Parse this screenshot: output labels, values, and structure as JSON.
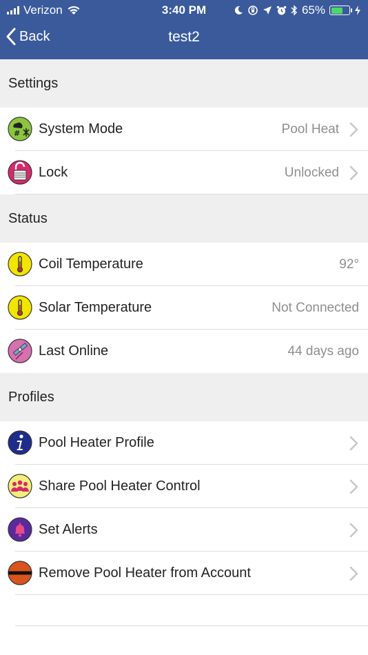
{
  "status_bar": {
    "carrier": "Verizon",
    "time": "3:40 PM",
    "battery_percent": "65%",
    "battery_level": 0.65
  },
  "nav": {
    "back_label": "Back",
    "title": "test2"
  },
  "sections": {
    "settings": {
      "title": "Settings",
      "rows": [
        {
          "label": "System Mode",
          "value": "Pool Heat"
        },
        {
          "label": "Lock",
          "value": "Unlocked"
        }
      ]
    },
    "status": {
      "title": "Status",
      "rows": [
        {
          "label": "Coil Temperature",
          "value": "92°"
        },
        {
          "label": "Solar Temperature",
          "value": "Not Connected"
        },
        {
          "label": "Last Online",
          "value": "44 days ago"
        }
      ]
    },
    "profiles": {
      "title": "Profiles",
      "rows": [
        {
          "label": "Pool Heater Profile"
        },
        {
          "label": "Share Pool Heater Control"
        },
        {
          "label": "Set Alerts"
        },
        {
          "label": "Remove Pool Heater from Account"
        }
      ]
    }
  },
  "colors": {
    "nav_bar": "#3a5a9c",
    "section_bg": "#efefef",
    "value_text": "#8e8e8e",
    "battery_fill": "#4cd964"
  },
  "icons": {
    "system_mode": "system-mode-icon",
    "lock": "lock-icon",
    "coil_temperature": "thermometer-icon",
    "solar_temperature": "thermometer-icon",
    "last_online": "satellite-icon",
    "profile": "info-icon",
    "share": "people-icon",
    "alerts": "bell-icon",
    "remove": "remove-icon"
  }
}
